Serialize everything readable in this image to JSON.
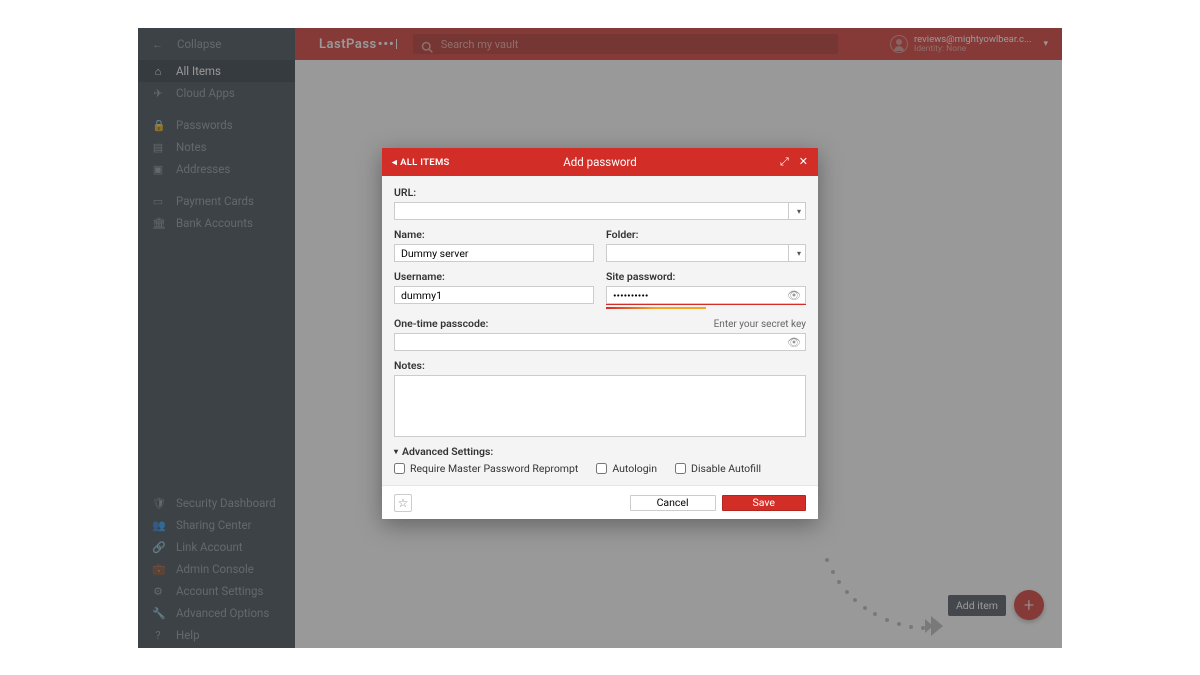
{
  "brand": {
    "name": "LastPass"
  },
  "search": {
    "placeholder": "Search my vault"
  },
  "user": {
    "email": "reviews@mightyowlbear.c...",
    "sub": "Identity: None"
  },
  "sidebar": {
    "collapse": "Collapse",
    "main": [
      {
        "label": "All Items",
        "icon": "home-icon",
        "active": true
      },
      {
        "label": "Cloud Apps",
        "icon": "plane-icon"
      }
    ],
    "types": [
      {
        "label": "Passwords",
        "icon": "lock-icon"
      },
      {
        "label": "Notes",
        "icon": "note-icon"
      },
      {
        "label": "Addresses",
        "icon": "address-icon"
      }
    ],
    "finance": [
      {
        "label": "Payment Cards",
        "icon": "card-icon"
      },
      {
        "label": "Bank Accounts",
        "icon": "bank-icon"
      }
    ],
    "bottom": [
      {
        "label": "Security Dashboard",
        "icon": "shield-icon"
      },
      {
        "label": "Sharing Center",
        "icon": "share-icon"
      },
      {
        "label": "Link Account",
        "icon": "link-icon"
      },
      {
        "label": "Admin Console",
        "icon": "briefcase-icon"
      },
      {
        "label": "Account Settings",
        "icon": "gear-icon"
      },
      {
        "label": "Advanced Options",
        "icon": "wrench-icon"
      },
      {
        "label": "Help",
        "icon": "help-icon"
      }
    ]
  },
  "fab": {
    "tooltip": "Add item",
    "glyph": "+"
  },
  "modal": {
    "back": "ALL ITEMS",
    "title": "Add password",
    "labels": {
      "url": "URL:",
      "name": "Name:",
      "folder": "Folder:",
      "username": "Username:",
      "site_password": "Site password:",
      "otp": "One-time passcode:",
      "otp_hint": "Enter your secret key",
      "notes": "Notes:",
      "advanced": "Advanced Settings:"
    },
    "values": {
      "url": "",
      "name": "Dummy server",
      "folder": "",
      "username": "dummy1",
      "password": "••••••••••",
      "otp": "",
      "notes": ""
    },
    "checkboxes": {
      "reprompt": "Require Master Password Reprompt",
      "autologin": "Autologin",
      "disable_autofill": "Disable Autofill"
    },
    "buttons": {
      "cancel": "Cancel",
      "save": "Save"
    }
  }
}
